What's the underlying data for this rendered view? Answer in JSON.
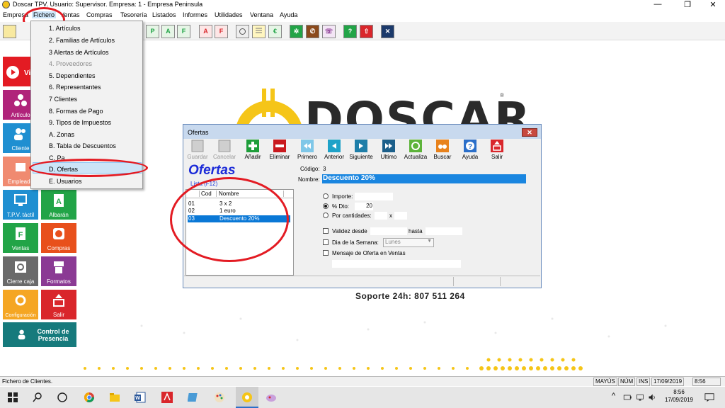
{
  "window": {
    "title": "Doscar TPV. Usuario: Supervisor. Empresa: 1 - Empresa Peninsula",
    "minimize": "—",
    "maximize": "❐",
    "close": "✕"
  },
  "menubar": [
    "Empresa",
    "Fichero",
    "Ventas",
    "Compras",
    "Tesorería",
    "Listados",
    "Informes",
    "Utilidades",
    "Ventana",
    "Ayuda"
  ],
  "toolbar_icons": [
    "P",
    "A",
    "F",
    "A",
    "F"
  ],
  "fichero_menu": {
    "items": [
      {
        "label": "1. Artículos",
        "enabled": true
      },
      {
        "label": "2. Familias de Artículos",
        "enabled": true
      },
      {
        "label": "3  Alertas de Artículos",
        "enabled": true
      },
      {
        "label": "4. Proveedores",
        "enabled": false
      },
      {
        "label": "5. Dependientes",
        "enabled": true
      },
      {
        "label": "6. Representantes",
        "enabled": true
      },
      {
        "label": "7 Clientes",
        "enabled": true
      },
      {
        "label": "8. Formas de Pago",
        "enabled": true
      },
      {
        "label": "9. Tipos de Impuestos",
        "enabled": true
      },
      {
        "label": "A. Zonas",
        "enabled": true
      },
      {
        "label": "B. Tabla de Descuentos",
        "enabled": true
      },
      {
        "label": "C. Pa...",
        "enabled": true
      },
      {
        "label": "D. Ofertas",
        "enabled": true
      },
      {
        "label": "E. Usuarios",
        "enabled": true
      }
    ],
    "highlighted": "D. Ofertas"
  },
  "sidebar": {
    "items": [
      {
        "label": "Vi",
        "color": "#e31b23"
      },
      {
        "label": "Artículo",
        "color": "#b0237a"
      },
      {
        "label": "Cliente",
        "color": "#1f8fd1"
      },
      {
        "label": "Empleado",
        "color": "#f08a70"
      },
      {
        "label": "T.P.V. táctil",
        "color": "#1f8fd1"
      },
      {
        "label": "Albarán",
        "color": "#22a447"
      },
      {
        "label": "Ventas",
        "color": "#22a447"
      },
      {
        "label": "Compras",
        "color": "#e8501c"
      },
      {
        "label": "Cierre caja",
        "color": "#6a6a6a"
      },
      {
        "label": "Formatos",
        "color": "#8b3a94"
      },
      {
        "label": "Configuración",
        "color": "#f5a623"
      },
      {
        "label": "Salir",
        "color": "#d9262b"
      }
    ],
    "presence_button": {
      "label": "Control de Presencia",
      "color": "#167a7c"
    }
  },
  "logo": {
    "brand": "DOSCAR",
    "reg": "®"
  },
  "dialog": {
    "title": "Ofertas",
    "close": "✕",
    "buttons": [
      {
        "label": "Guardar",
        "enabled": false,
        "color": "#9a9a9a"
      },
      {
        "label": "Cancelar",
        "enabled": false,
        "color": "#9a9a9a"
      },
      {
        "label": "Añadir",
        "enabled": true,
        "color": "#1e9e3a"
      },
      {
        "label": "Eliminar",
        "enabled": true,
        "color": "#c9191e"
      },
      {
        "label": "Primero",
        "enabled": true,
        "color": "#7fc7e8"
      },
      {
        "label": "Anterior",
        "enabled": true,
        "color": "#1ea2c8"
      },
      {
        "label": "Siguiente",
        "enabled": true,
        "color": "#1e7ea8"
      },
      {
        "label": "Ultimo",
        "enabled": true,
        "color": "#1c5f8a"
      },
      {
        "label": "Actualiza",
        "enabled": true,
        "color": "#5db33a"
      },
      {
        "label": "Buscar",
        "enabled": true,
        "color": "#e8821c"
      },
      {
        "label": "Ayuda",
        "enabled": true,
        "color": "#2b6fc9"
      },
      {
        "label": "Salir",
        "enabled": true,
        "color": "#d9262b"
      }
    ],
    "heading": "Ofertas",
    "list_link": "Lista (F12)",
    "list": {
      "columns": [
        "Cod",
        "Nombre"
      ],
      "rows": [
        {
          "cod": "01",
          "nombre": "3 x 2",
          "selected": false
        },
        {
          "cod": "02",
          "nombre": "1 euro",
          "selected": false
        },
        {
          "cod": "03",
          "nombre": "Descuento 20%",
          "selected": true
        }
      ]
    },
    "form": {
      "codigo_label": "Código:",
      "codigo_value": "3",
      "nombre_label": "Nombre:",
      "nombre_value": "Descuento 20%",
      "importe_label": "Importe:",
      "dto_label": "% Dto:",
      "dto_value": "20",
      "cantidades_label": "Por cantidades:",
      "cantidades_x": "x",
      "selected_option": "% Dto:",
      "validez_label": "Validez desde",
      "hasta_label": "hasta",
      "dia_label": "Dia de la Semana:",
      "dia_value": "Lunes",
      "mensaje_label": "Mensaje de Oferta en Ventas"
    }
  },
  "support_text": "Soporte 24h: 807 511 264",
  "status": {
    "message": "Fichero de Clientes.",
    "cells": [
      "MAYÚS",
      "NÚM",
      "INS",
      "17/09/2019",
      "8:56"
    ]
  },
  "taskbar": {
    "time": "8:56",
    "date": "17/09/2019"
  },
  "colors": {
    "accent_red": "#e31b23",
    "dialog_title_blue": "#1c2bd8",
    "selection_blue": "#0a78d6",
    "logo_yellow": "#f5c518"
  }
}
